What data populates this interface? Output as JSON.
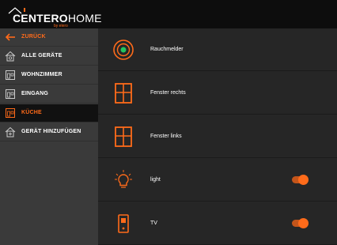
{
  "brand": {
    "name_bold": "CENTERO",
    "name_thin": "HOME",
    "tagline": "by elero",
    "accent": "#ff6b1a"
  },
  "sidebar": {
    "items": [
      {
        "label": "ZURÜCK",
        "icon": "arrow-left-icon",
        "type": "back"
      },
      {
        "label": "ALLE GERÄTE",
        "icon": "house-plug-icon"
      },
      {
        "label": "WOHNZIMMER",
        "icon": "room-icon"
      },
      {
        "label": "EINGANG",
        "icon": "room-icon"
      },
      {
        "label": "KÜCHE",
        "icon": "room-icon",
        "active": true
      },
      {
        "label": "GERÄT HINZUFÜGEN",
        "icon": "house-plus-icon"
      }
    ]
  },
  "devices": [
    {
      "label": "Rauchmelder",
      "icon": "smoke-detector-icon"
    },
    {
      "label": "Fenster rechts",
      "icon": "window-icon"
    },
    {
      "label": "Fenster links",
      "icon": "window-icon"
    },
    {
      "label": "light",
      "icon": "lightbulb-icon",
      "toggle": true,
      "on": true
    },
    {
      "label": "TV",
      "icon": "tv-switch-icon",
      "toggle": true,
      "on": true
    }
  ]
}
